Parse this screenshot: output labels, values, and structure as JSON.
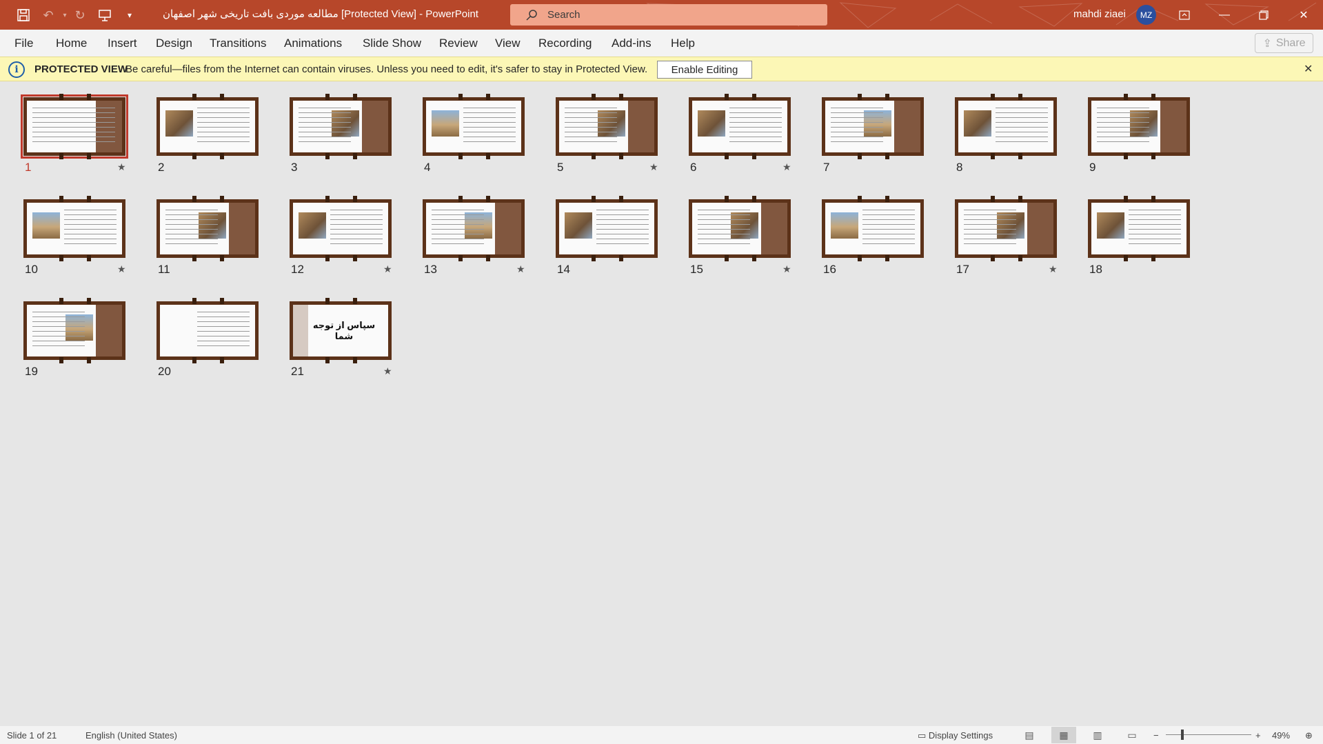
{
  "titlebar": {
    "document_title": "مطالعه موردی بافت تاریخی شهر اصفهان [Protected View]  -  PowerPoint",
    "search_placeholder": "Search",
    "user_name": "mahdi ziaei",
    "user_initials": "MZ",
    "accent_color": "#b7472a"
  },
  "menu": {
    "items": [
      "File",
      "Home",
      "Insert",
      "Design",
      "Transitions",
      "Animations",
      "Slide Show",
      "Review",
      "View",
      "Recording",
      "Add-ins",
      "Help"
    ],
    "share_label": "Share"
  },
  "protected_view": {
    "title": "PROTECTED VIEW",
    "message": "Be careful—files from the Internet can contain viruses. Unless you need to edit, it's safer to stay in Protected View.",
    "enable_button": "Enable Editing"
  },
  "slides": [
    {
      "number": "1",
      "star": true,
      "selected": true
    },
    {
      "number": "2",
      "star": false
    },
    {
      "number": "3",
      "star": false
    },
    {
      "number": "4",
      "star": false
    },
    {
      "number": "5",
      "star": true
    },
    {
      "number": "6",
      "star": true
    },
    {
      "number": "7",
      "star": false
    },
    {
      "number": "8",
      "star": false
    },
    {
      "number": "9",
      "star": false
    },
    {
      "number": "10",
      "star": true
    },
    {
      "number": "11",
      "star": false
    },
    {
      "number": "12",
      "star": true
    },
    {
      "number": "13",
      "star": true
    },
    {
      "number": "14",
      "star": false
    },
    {
      "number": "15",
      "star": true
    },
    {
      "number": "16",
      "star": false
    },
    {
      "number": "17",
      "star": true
    },
    {
      "number": "18",
      "star": false
    },
    {
      "number": "19",
      "star": false
    },
    {
      "number": "20",
      "star": false
    },
    {
      "number": "21",
      "star": true,
      "text": "سپاس از توجه شما"
    }
  ],
  "statusbar": {
    "slide_info": "Slide 1 of 21",
    "language": "English (United States)",
    "display_settings": "Display Settings",
    "zoom": "49%"
  }
}
